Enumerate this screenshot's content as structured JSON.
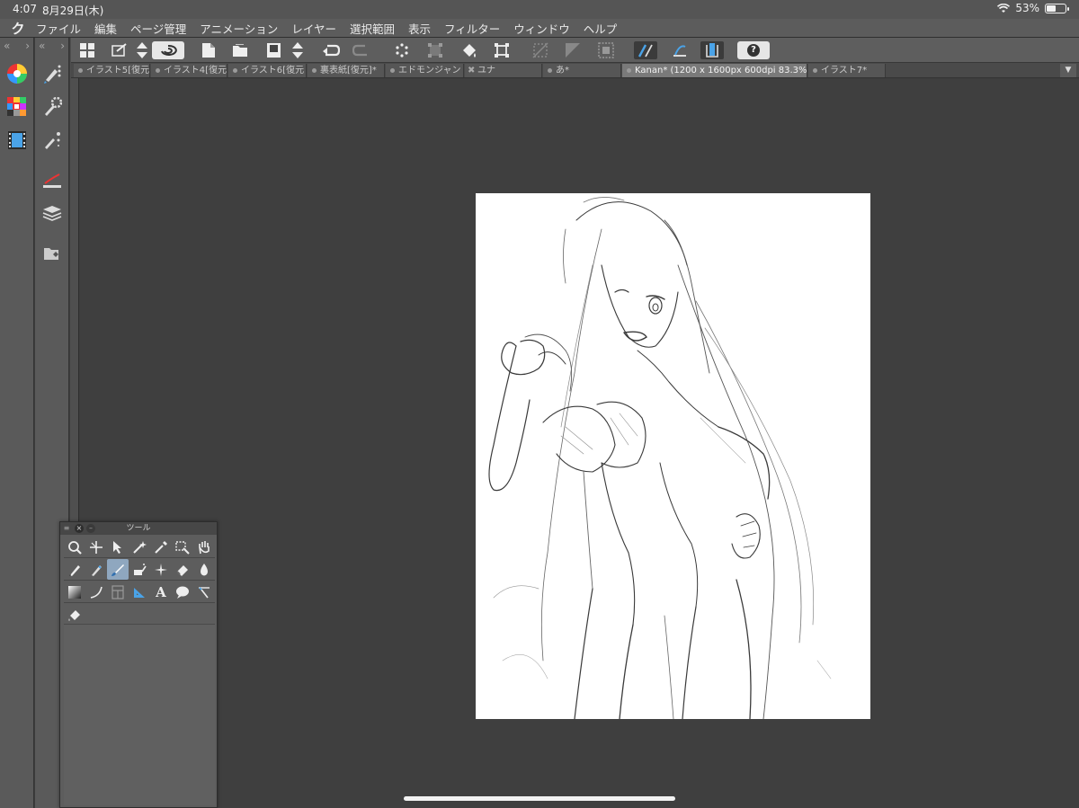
{
  "status_bar": {
    "time": "4:07",
    "date": "8月29日(木)",
    "battery": "53%",
    "battery_level": 0.53,
    "icons": [
      "wifi-icon",
      "battery-icon"
    ]
  },
  "menu": {
    "logo": "ク",
    "items": [
      "ファイル",
      "編集",
      "ページ管理",
      "アニメーション",
      "レイヤー",
      "選択範囲",
      "表示",
      "フィルター",
      "ウィンドウ",
      "ヘルプ"
    ]
  },
  "side_icons": {
    "strip1": [
      "color-wheel-icon",
      "color-set-icon",
      "animation-icon"
    ],
    "strip2": [
      "sub-tool-icon",
      "tool-property-icon",
      "brush-size-icon",
      "layer-property-icon",
      "layer-icon",
      "material-icon"
    ]
  },
  "toolbar": {
    "items": [
      "layout-icon",
      "import-icon",
      "up-down-icon",
      "rotate-icon",
      "new-icon",
      "open-icon",
      "save-icon",
      "up-down-icon",
      "undo-icon",
      "redo-icon",
      "clear-icon",
      "transform-icon",
      "fill-icon",
      "selection-icon",
      "hide-icon",
      "invert-icon",
      "canvas-icon",
      "ruler-snap-icon",
      "special-ruler-icon",
      "grid-snap-icon",
      "help-icon"
    ],
    "help_label": "?"
  },
  "tabs": [
    {
      "label": "イラスト5[復元",
      "marker": "dot"
    },
    {
      "label": "イラスト4[復元",
      "marker": "dot"
    },
    {
      "label": "イラスト6[復元",
      "marker": "dot"
    },
    {
      "label": "裏表紙[復元]*",
      "marker": "dot"
    },
    {
      "label": "エドモンジャン",
      "marker": "dot"
    },
    {
      "label": "ユナ",
      "marker": "close"
    },
    {
      "label": "あ*",
      "marker": "dot"
    },
    {
      "label": "Kanan* (1200 x 1600px 600dpi 83.3%)",
      "marker": "dot",
      "active": true
    },
    {
      "label": "イラスト7*",
      "marker": "dot"
    }
  ],
  "tab_overflow": "▼",
  "canvas": {
    "document_name": "Kanan*",
    "size": "1200 x 1600px",
    "dpi": "600dpi",
    "zoom": "83.3%"
  },
  "tool_palette": {
    "title": "ツール",
    "close_label": "×",
    "rows": [
      [
        "zoom-icon",
        "move-icon",
        "operation-icon",
        "auto-select-icon",
        "eyedropper-icon",
        "select-icon",
        "hand-icon"
      ],
      [
        "pen-icon",
        "pencil-icon",
        "brush-icon",
        "airbrush-icon",
        "decoration-icon",
        "eraser-icon",
        "blend-icon"
      ],
      [
        "gradient-icon",
        "figure-icon",
        "frame-icon",
        "ruler-icon",
        "text-icon",
        "balloon-icon",
        "correct-line-icon"
      ],
      [
        "fill-bucket-icon"
      ]
    ],
    "selected_tool": "brush-icon"
  }
}
